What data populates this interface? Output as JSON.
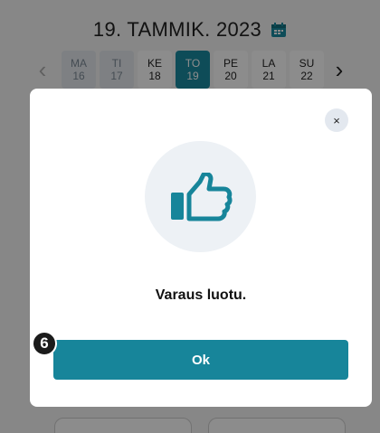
{
  "header": {
    "date_title": "19. TAMMIK. 2023",
    "calendar_icon": "calendar-icon"
  },
  "week": {
    "prev_icon": "chevron-left-icon",
    "next_icon": "chevron-right-icon",
    "days": [
      {
        "name": "MA",
        "num": "16"
      },
      {
        "name": "TI",
        "num": "17"
      },
      {
        "name": "KE",
        "num": "18"
      },
      {
        "name": "TO",
        "num": "19"
      },
      {
        "name": "PE",
        "num": "20"
      },
      {
        "name": "LA",
        "num": "21"
      },
      {
        "name": "SU",
        "num": "22"
      }
    ]
  },
  "modal": {
    "close_symbol": "×",
    "icon": "thumbs-up-icon",
    "message": "Varaus luotu.",
    "ok_label": "Ok"
  },
  "annotation": {
    "step_number": "6"
  },
  "colors": {
    "accent": "#17859a",
    "selected_day": "#1a8aa0",
    "past_day": "#e5e9ee",
    "icon_circle": "#edf1f5"
  }
}
